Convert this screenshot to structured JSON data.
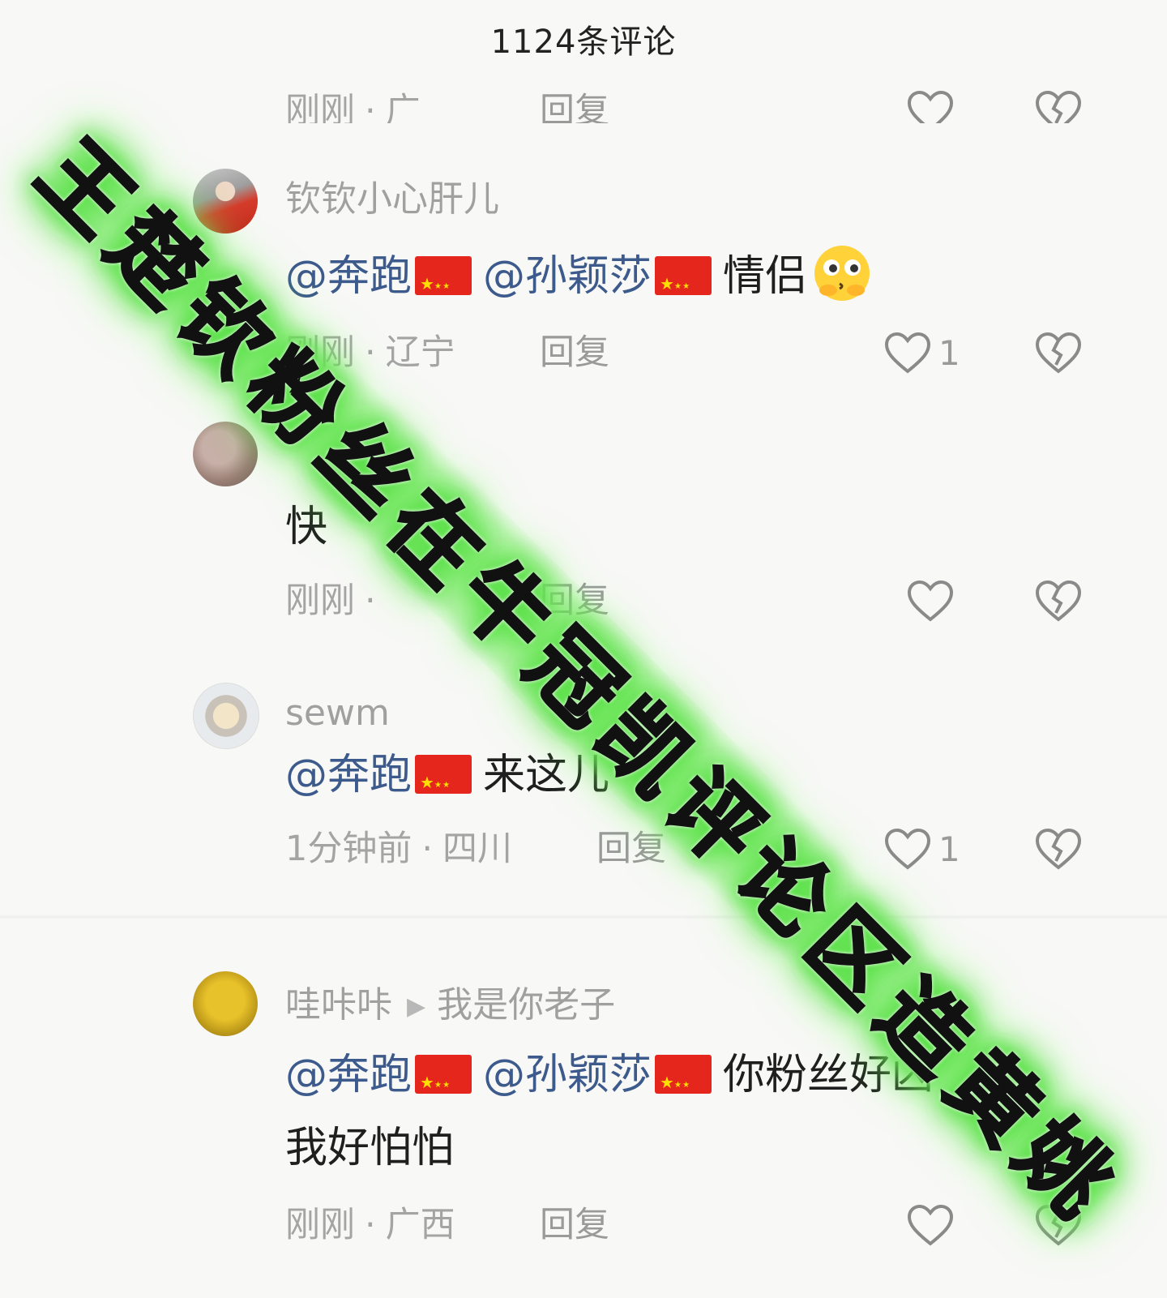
{
  "header": {
    "title": "1124条评论"
  },
  "top_clipped": {
    "time": "刚刚",
    "location": "广",
    "reply": "回复"
  },
  "comments": [
    {
      "username": "钦钦小心肝儿",
      "content": {
        "mentions": [
          "@奔跑",
          "@孙颖莎"
        ],
        "text": "情侣"
      },
      "time": "刚刚",
      "location": "辽宁",
      "reply": "回复",
      "likes": "1"
    },
    {
      "username": "",
      "content": {
        "text": "快"
      },
      "time": "刚刚",
      "location": "",
      "reply": "回复",
      "likes": ""
    },
    {
      "username": "sewm",
      "content": {
        "mentions": [
          "@奔跑"
        ],
        "text": "来这儿"
      },
      "time": "1分钟前",
      "location": "四川",
      "reply": "回复",
      "likes": "1"
    },
    {
      "username": "哇咔咔",
      "reply_to": "我是你老子",
      "content": {
        "mentions": [
          "@奔跑",
          "@孙颖莎"
        ],
        "text": "你粉丝好凶",
        "line2": "我好怕怕"
      },
      "time": "刚刚",
      "location": "广西",
      "reply": "回复",
      "likes": ""
    }
  ],
  "overlay": {
    "banner": "王楚钦粉丝在牛冠凯评论区造黄姚"
  },
  "icons": {
    "like": "heart-outline-icon",
    "dislike": "broken-heart-icon",
    "flag": "china-flag-icon",
    "emoji": "kissing-face-emoji-icon"
  },
  "colors": {
    "mention": "#3d5a8c",
    "meta": "#a4a4a4",
    "banner_glow": "#5ce04a",
    "flag_red": "#e4261c",
    "flag_star": "#ffde00"
  }
}
